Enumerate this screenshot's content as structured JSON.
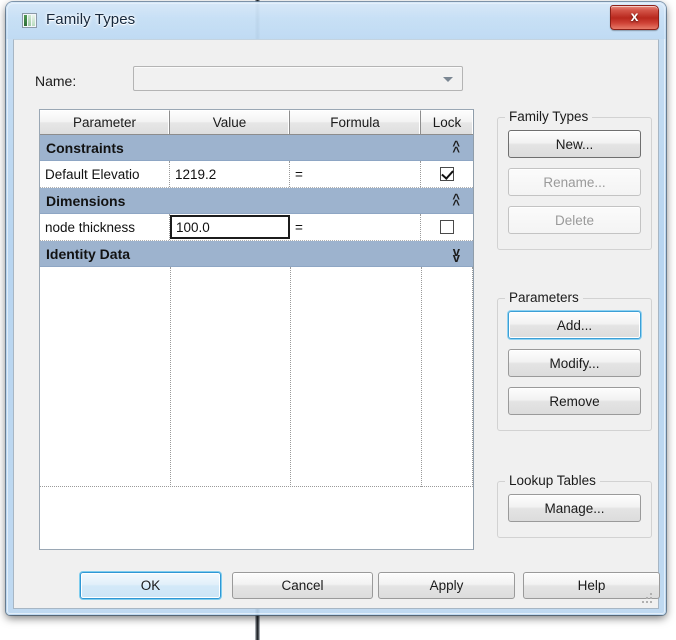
{
  "window": {
    "title": "Family Types",
    "icon": "family-types-icon",
    "close_label": "x"
  },
  "form": {
    "name_label": "Name:",
    "name_value": "",
    "name_placeholder": ""
  },
  "table": {
    "columns": [
      "Parameter",
      "Value",
      "Formula",
      "Lock"
    ],
    "groups": [
      {
        "name": "Constraints",
        "state": "expanded",
        "chevron": "up",
        "rows": [
          {
            "parameter": "Default Elevatio",
            "value": "1219.2",
            "formula": "=",
            "locked": true,
            "editing": false
          }
        ]
      },
      {
        "name": "Dimensions",
        "state": "expanded",
        "chevron": "up",
        "rows": [
          {
            "parameter": "node thickness",
            "value": "100.0",
            "formula": "=",
            "locked": false,
            "editing": true
          }
        ]
      },
      {
        "name": "Identity Data",
        "state": "collapsed",
        "chevron": "down",
        "rows": []
      }
    ]
  },
  "panels": {
    "family_types": {
      "legend": "Family Types",
      "buttons": [
        {
          "label": "New...",
          "state": "pressed"
        },
        {
          "label": "Rename...",
          "state": "disabled"
        },
        {
          "label": "Delete",
          "state": "disabled"
        }
      ]
    },
    "parameters": {
      "legend": "Parameters",
      "buttons": [
        {
          "label": "Add...",
          "state": "focus"
        },
        {
          "label": "Modify...",
          "state": "normal"
        },
        {
          "label": "Remove",
          "state": "normal"
        }
      ]
    },
    "lookup_tables": {
      "legend": "Lookup Tables",
      "buttons": [
        {
          "label": "Manage...",
          "state": "normal"
        }
      ]
    }
  },
  "footer": {
    "buttons": [
      {
        "label": "OK",
        "state": "defaulted"
      },
      {
        "label": "Cancel",
        "state": "normal"
      },
      {
        "label": "Apply",
        "state": "normal"
      },
      {
        "label": "Help",
        "state": "normal"
      }
    ]
  },
  "colors": {
    "group_header": "#9db3ce",
    "titlebar_glass": "#bad8f3",
    "close_button": "#b8281d",
    "focus_blue": "#2f97d4",
    "client_background": "#f0f0f0"
  }
}
